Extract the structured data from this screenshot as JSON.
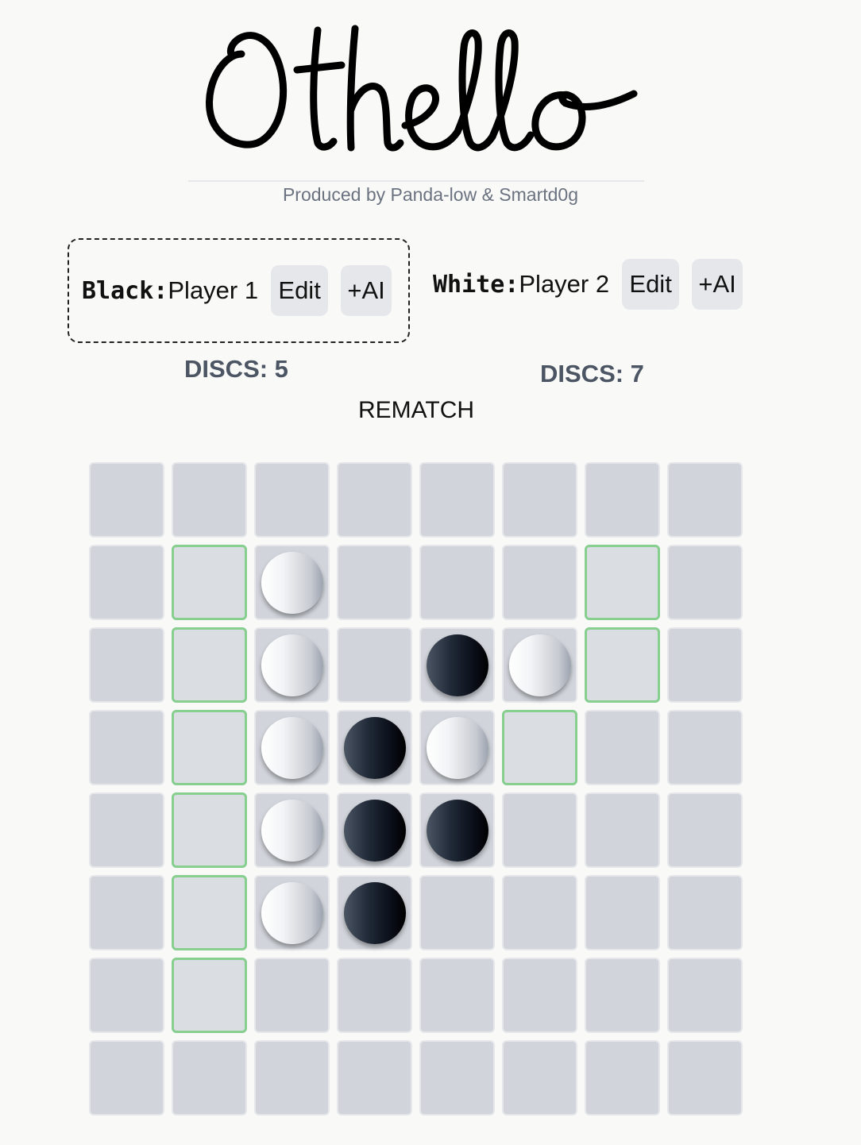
{
  "header": {
    "title": "Othello",
    "subtitle": "Produced by Panda-low & Smartd0g"
  },
  "players": {
    "black": {
      "label": "Black:",
      "name": "Player 1",
      "edit_label": "Edit",
      "ai_label": "+AI",
      "discs_text": "DISCS: 5",
      "active": true
    },
    "white": {
      "label": "White:",
      "name": "Player 2",
      "edit_label": "Edit",
      "ai_label": "+AI",
      "discs_text": "DISCS: 7",
      "active": false
    }
  },
  "rematch_label": "REMATCH",
  "colors": {
    "hint_border": "#86cf8f",
    "cell": "#d1d5db",
    "background": "#f9f9f7"
  },
  "board": {
    "rows": [
      "........",
      ".+W...+.",
      ".+W.BW+.",
      ".+WBW+..",
      ".+WBB...",
      ".+WB....",
      ".+......",
      "........"
    ],
    "legend": {
      "B": "black disc",
      "W": "white disc",
      "+": "legal move hint",
      ".": "empty"
    }
  }
}
